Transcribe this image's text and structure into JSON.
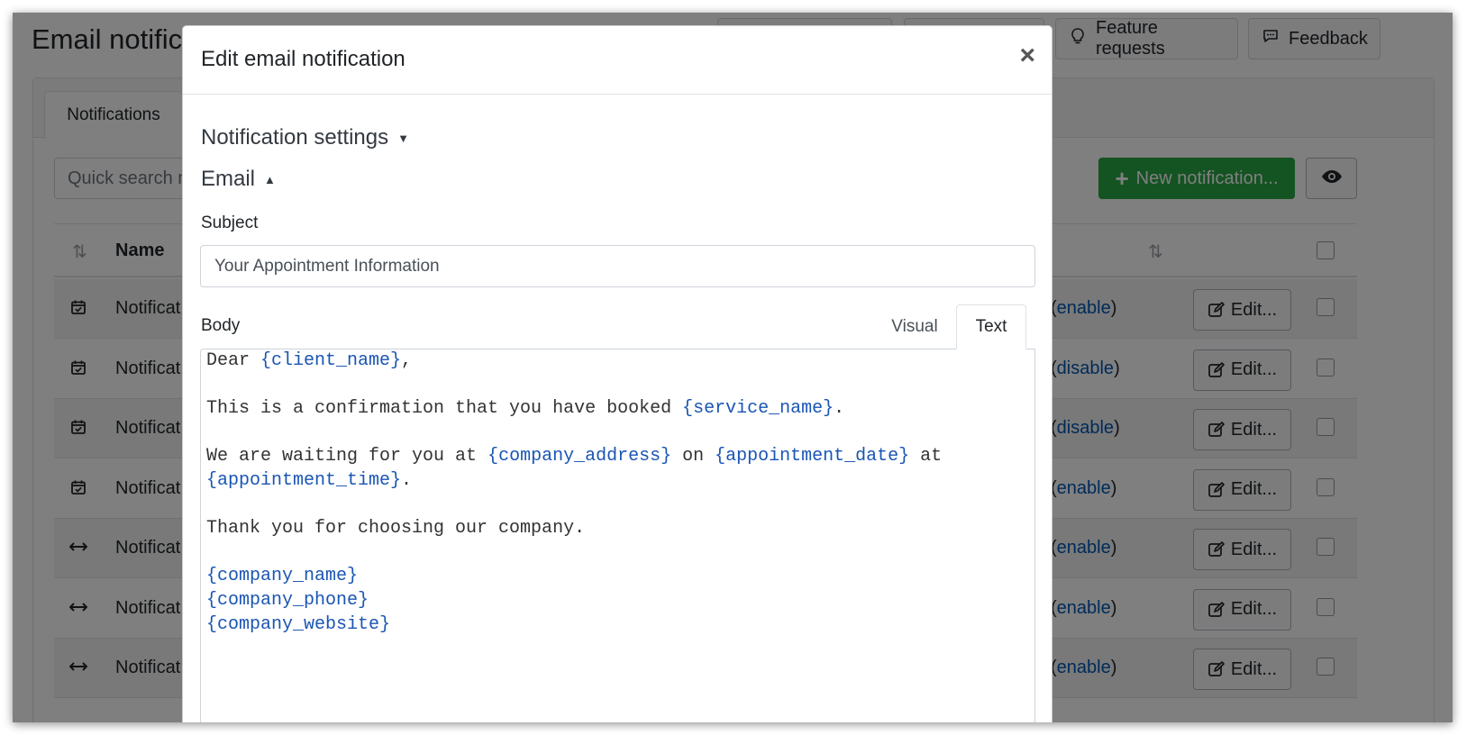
{
  "page": {
    "title": "Email notifications",
    "top_buttons": [
      {
        "label": "",
        "icon": ""
      },
      {
        "label": "",
        "icon": ""
      },
      {
        "label": "Feature requests",
        "icon": "lightbulb-icon"
      },
      {
        "label": "Feedback",
        "icon": "chat-bubble-icon"
      }
    ],
    "tabs": [
      {
        "label": "Notifications"
      }
    ],
    "quick_search_placeholder": "Quick search n",
    "new_button_label": "New notification...",
    "table": {
      "columns": [
        "Name"
      ],
      "rows": [
        {
          "name": "Notificat",
          "icon": "calendar-check-icon",
          "toggle_prefix": "(",
          "toggle_link": "enable",
          "toggle_suffix": ")",
          "edit_label": "Edit..."
        },
        {
          "name": "Notificat",
          "icon": "calendar-check-icon",
          "toggle_prefix": "(",
          "toggle_link": "disable",
          "toggle_suffix": ")",
          "edit_label": "Edit..."
        },
        {
          "name": "Notificat",
          "icon": "calendar-check-icon",
          "toggle_prefix": "(",
          "toggle_link": "disable",
          "toggle_suffix": ")",
          "edit_label": "Edit..."
        },
        {
          "name": "Notificat",
          "icon": "calendar-check-icon",
          "toggle_prefix": "(",
          "toggle_link": "enable",
          "toggle_suffix": ")",
          "edit_label": "Edit..."
        },
        {
          "name": "Notificat",
          "icon": "arrows-horizontal-icon",
          "toggle_prefix": "(",
          "toggle_link": "enable",
          "toggle_suffix": ")",
          "edit_label": "Edit..."
        },
        {
          "name": "Notificat",
          "icon": "arrows-horizontal-icon",
          "toggle_prefix": "(",
          "toggle_link": "enable",
          "toggle_suffix": ")",
          "edit_label": "Edit..."
        },
        {
          "name": "Notificat",
          "icon": "arrows-horizontal-icon",
          "toggle_prefix": "(",
          "toggle_link": "enable",
          "toggle_suffix": ")",
          "edit_label": "Edit..."
        }
      ]
    }
  },
  "modal": {
    "title": "Edit email notification",
    "close_glyph": "×",
    "notification_settings_label": "Notification settings",
    "email_section_label": "Email",
    "subject_label": "Subject",
    "subject_value": "Your Appointment Information",
    "body_label": "Body",
    "body_tabs": [
      "Visual",
      "Text"
    ],
    "active_body_tab": "Text",
    "body_lines": [
      [
        {
          "t": "Dear "
        },
        {
          "t": "{client_name}",
          "tag": true
        },
        {
          "t": ","
        }
      ],
      [],
      [
        {
          "t": "This is a confirmation that you have booked "
        },
        {
          "t": "{service_name}",
          "tag": true
        },
        {
          "t": "."
        }
      ],
      [],
      [
        {
          "t": "We are waiting for you at "
        },
        {
          "t": "{company_address}",
          "tag": true
        },
        {
          "t": " on "
        },
        {
          "t": "{appointment_date}",
          "tag": true
        },
        {
          "t": " at"
        }
      ],
      [
        {
          "t": "{appointment_time}",
          "tag": true
        },
        {
          "t": "."
        }
      ],
      [],
      [
        {
          "t": "Thank you for choosing our company."
        }
      ],
      [],
      [
        {
          "t": "{company_name}",
          "tag": true
        }
      ],
      [
        {
          "t": "{company_phone}",
          "tag": true
        }
      ],
      [
        {
          "t": "{company_website}",
          "tag": true
        }
      ]
    ]
  },
  "colors": {
    "accent_green": "#28a745",
    "link_blue": "#0056b3",
    "template_tag_blue": "#1a55b4",
    "backdrop": "rgba(0,0,0,0.5)"
  }
}
